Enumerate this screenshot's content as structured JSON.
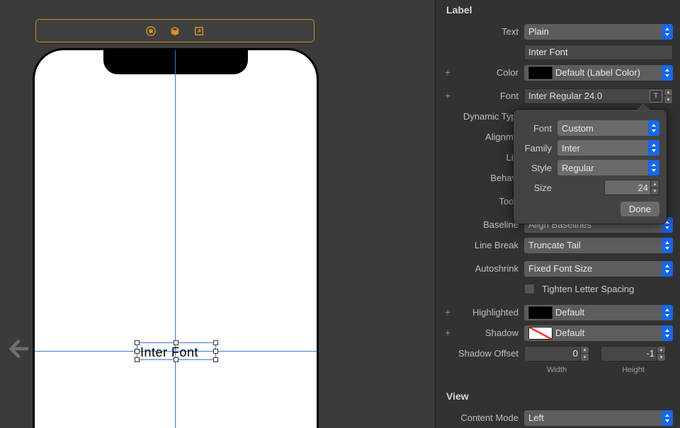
{
  "canvas": {
    "selected_label_text": "Inter Font"
  },
  "inspector": {
    "section_label": "Label",
    "text": {
      "label": "Text",
      "style": "Plain",
      "value": "Inter Font"
    },
    "color": {
      "label": "Color",
      "value": "Default (Label Color)"
    },
    "font": {
      "label": "Font",
      "value": "Inter Regular 24.0"
    },
    "dynamic_type": {
      "label": "Dynamic Type"
    },
    "alignment_label_trunc": "Alignme",
    "lines_label_trunc": "Lin",
    "behavior_label_trunc": "Behavi",
    "tooltip_label_trunc": "Toolt",
    "baseline": {
      "label": "Baseline",
      "value": "Align Baselines"
    },
    "line_break": {
      "label": "Line Break",
      "value": "Truncate Tail"
    },
    "autoshrink": {
      "label": "Autoshrink",
      "value": "Fixed Font Size"
    },
    "tighten": {
      "label": "Tighten Letter Spacing"
    },
    "highlighted": {
      "label": "Highlighted",
      "value": "Default"
    },
    "shadow": {
      "label": "Shadow",
      "value": "Default"
    },
    "shadow_offset": {
      "label": "Shadow Offset",
      "width": "0",
      "width_label": "Width",
      "height": "-1",
      "height_label": "Height"
    },
    "section_view": "View",
    "content_mode": {
      "label": "Content Mode",
      "value": "Left"
    }
  },
  "popover": {
    "font": {
      "label": "Font",
      "value": "Custom"
    },
    "family": {
      "label": "Family",
      "value": "Inter"
    },
    "style": {
      "label": "Style",
      "value": "Regular"
    },
    "size": {
      "label": "Size",
      "value": "24"
    },
    "done": "Done"
  }
}
